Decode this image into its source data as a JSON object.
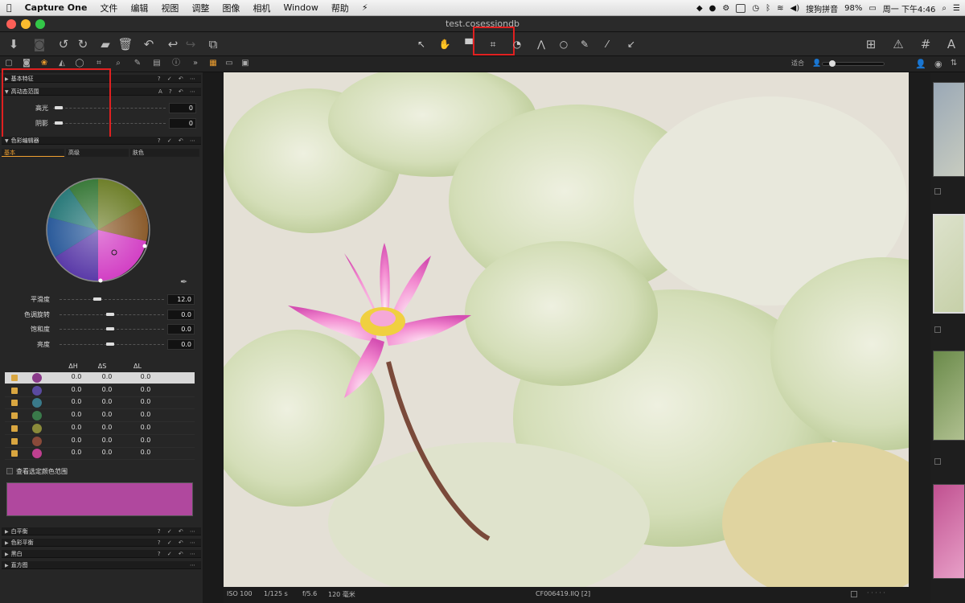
{
  "menubar": {
    "app_name": "Capture One",
    "items": [
      "文件",
      "编辑",
      "视图",
      "调整",
      "图像",
      "相机",
      "Window",
      "帮助"
    ],
    "battery": "98%",
    "clock": "周一 下午4:46",
    "input_method": "搜狗拼音"
  },
  "window": {
    "title": "test.cosessiondb"
  },
  "subtoolbar": {
    "viewer_label": "适合"
  },
  "left_panel": {
    "basic_characteristics": "基本特征",
    "hdr_tool": "高动态范围",
    "highlight_label": "高光",
    "highlight_value": "0",
    "shadow_label": "阴影",
    "shadow_value": "0",
    "color_editor": "色彩编辑器",
    "tabs": [
      "基本",
      "高级",
      "肤色"
    ],
    "smoothness_label": "平滑度",
    "smoothness_value": "12.0",
    "hue_rotation_label": "色调旋转",
    "hue_rotation_value": "0.0",
    "saturation_label": "饱和度",
    "saturation_value": "0.0",
    "lightness_label": "亮度",
    "lightness_value": "0.0",
    "table_headers": [
      "ΔH",
      "ΔS",
      "ΔL"
    ],
    "rows": [
      {
        "color": "#8a3a8a",
        "dh": "0.0",
        "ds": "0.0",
        "dl": "0.0"
      },
      {
        "color": "#5a4aa0",
        "dh": "0.0",
        "ds": "0.0",
        "dl": "0.0"
      },
      {
        "color": "#3a7a8a",
        "dh": "0.0",
        "ds": "0.0",
        "dl": "0.0"
      },
      {
        "color": "#3a7a4a",
        "dh": "0.0",
        "ds": "0.0",
        "dl": "0.0"
      },
      {
        "color": "#8a8a3a",
        "dh": "0.0",
        "ds": "0.0",
        "dl": "0.0"
      },
      {
        "color": "#8a4a3a",
        "dh": "0.0",
        "ds": "0.0",
        "dl": "0.0"
      },
      {
        "color": "#c04090",
        "dh": "0.0",
        "ds": "0.0",
        "dl": "0.0"
      }
    ],
    "view_selected_range": "查看选定颜色范围",
    "swatch_color": "#b0489e",
    "white_balance": "白平衡",
    "color_balance": "色彩平衡",
    "black_white": "黑白",
    "histogram": "直方图"
  },
  "statusbar": {
    "iso": "ISO 100",
    "shutter": "1/125 s",
    "aperture": "f/5.6",
    "focal": "120 毫米",
    "filename": "CF006419.IIQ [2]"
  }
}
